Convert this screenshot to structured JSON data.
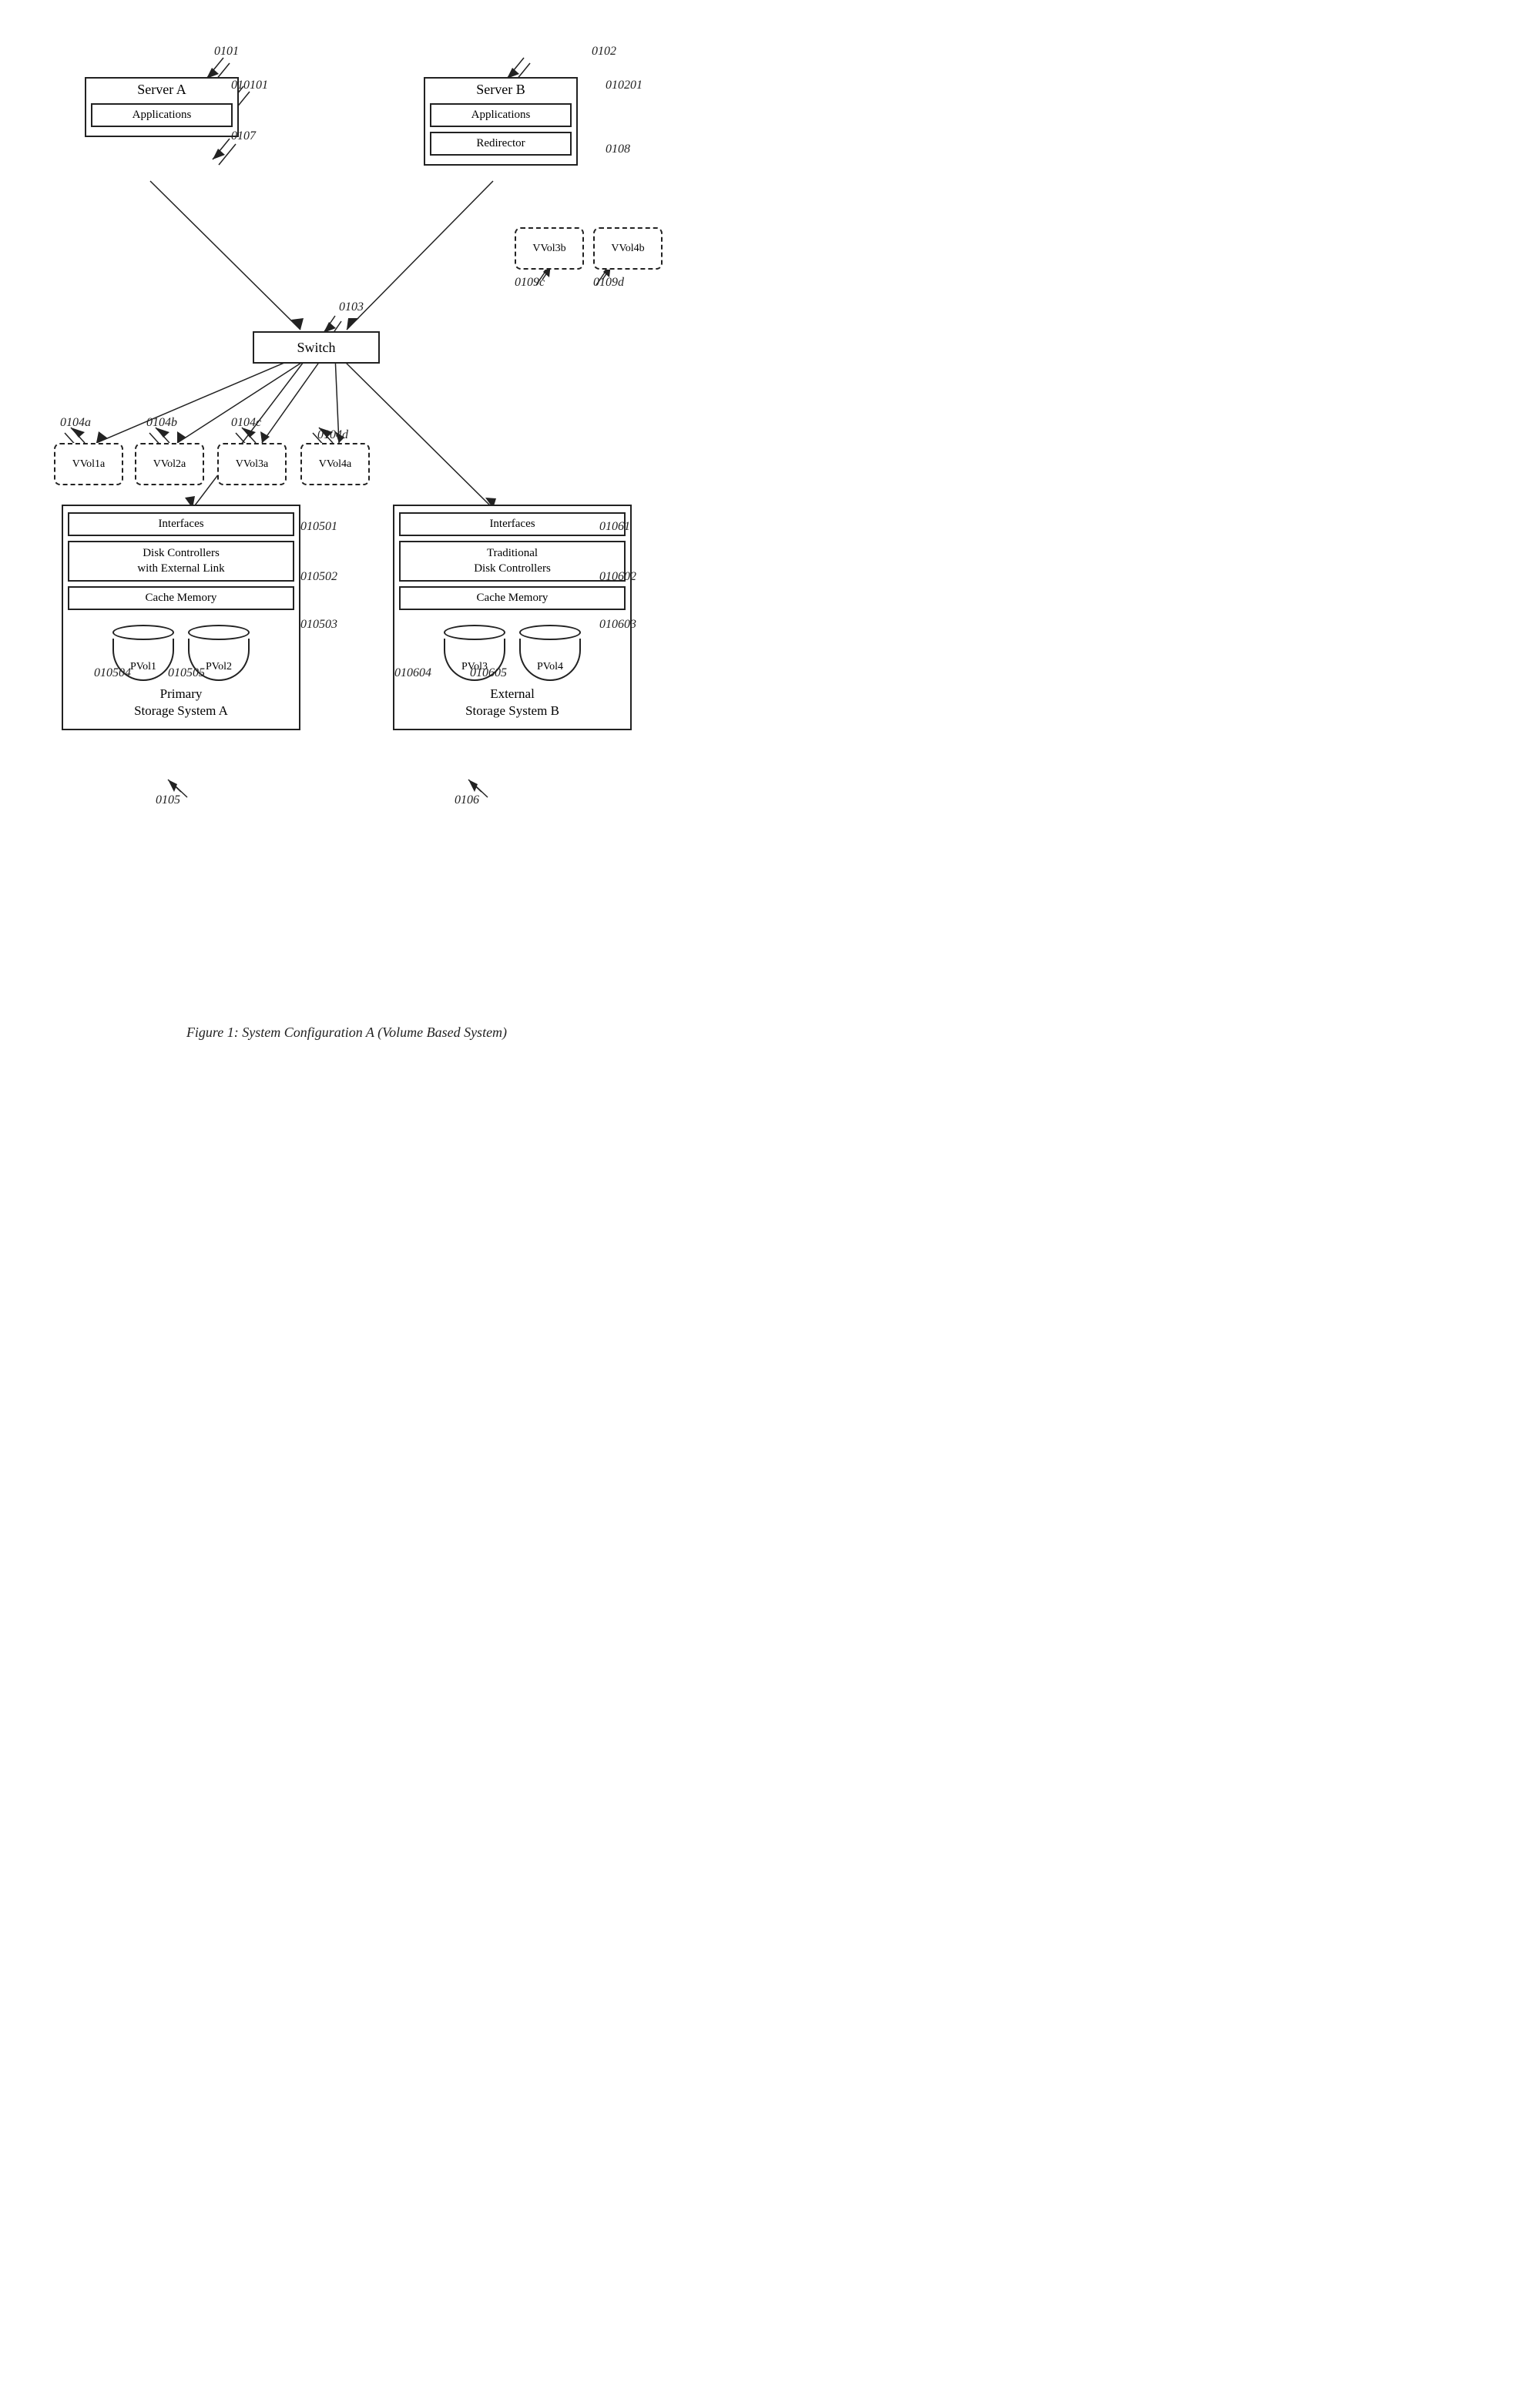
{
  "diagram": {
    "title": "Figure 1: System Configuration A (Volume Based System)",
    "servers": [
      {
        "id": "server-a",
        "label": "Server A",
        "inner": [
          "Applications"
        ],
        "ref": "0101",
        "ref2": "010101",
        "ref3": "0107"
      },
      {
        "id": "server-b",
        "label": "Server B",
        "inner": [
          "Applications",
          "Redirector"
        ],
        "ref": "0102",
        "ref2": "010201",
        "ref3": "0108"
      }
    ],
    "switch": {
      "label": "Switch",
      "ref": "0103"
    },
    "vvols_switch": [
      {
        "label": "VVol1a",
        "ref": "0104a"
      },
      {
        "label": "VVol2a",
        "ref": "0104b"
      },
      {
        "label": "VVol3a",
        "ref": "0104c"
      },
      {
        "label": "VVol4a",
        "ref": "0104d"
      }
    ],
    "vvols_server_b": [
      {
        "label": "VVol3b",
        "ref": "0109c"
      },
      {
        "label": "VVol4b",
        "ref": "0109d"
      }
    ],
    "storage_a": {
      "label": "Primary\nStorage System A",
      "ref": "0105",
      "inner": [
        {
          "label": "Interfaces",
          "ref": "010501"
        },
        {
          "label": "Disk Controllers\nwith External Link",
          "ref": "010502"
        },
        {
          "label": "Cache Memory",
          "ref": "010503"
        }
      ],
      "pvols": [
        {
          "label": "PVol1",
          "ref": "010504"
        },
        {
          "label": "PVol2",
          "ref": "010505"
        }
      ]
    },
    "storage_b": {
      "label": "External\nStorage System B",
      "ref": "0106",
      "inner": [
        {
          "label": "Interfaces",
          "ref": "01061"
        },
        {
          "label": "Traditional\nDisk Controllers",
          "ref": "010602"
        },
        {
          "label": "Cache Memory",
          "ref": "010603"
        }
      ],
      "pvols": [
        {
          "label": "PVol3",
          "ref": "010604"
        },
        {
          "label": "PVol4",
          "ref": "010605"
        }
      ]
    }
  }
}
